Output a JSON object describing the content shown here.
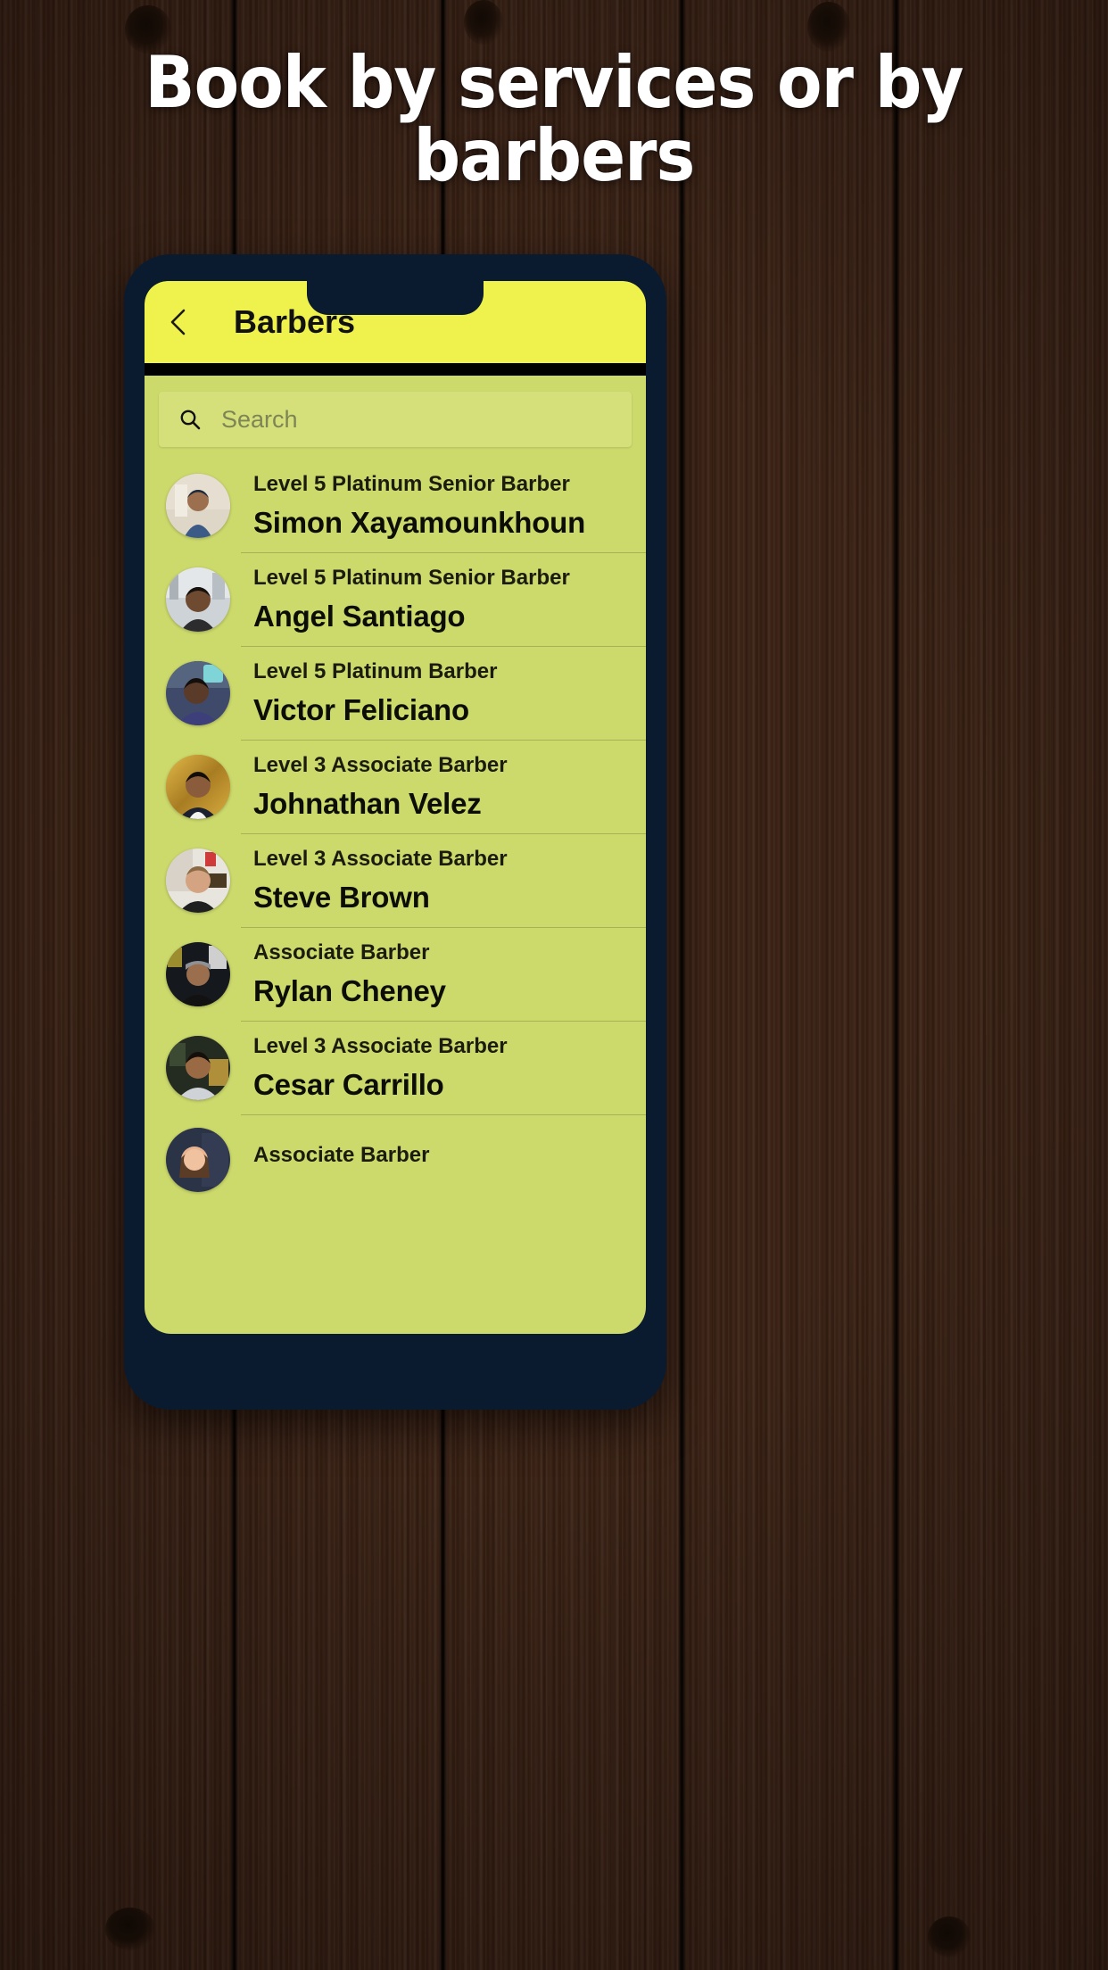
{
  "headline": "Book by services or by barbers",
  "phone": {
    "navbar": {
      "back_icon": "chevron-left-icon",
      "title": "Barbers"
    },
    "search": {
      "icon": "search-icon",
      "placeholder": "Search",
      "value": ""
    },
    "barbers": [
      {
        "level": "Level 5 Platinum Senior Barber",
        "name": "Simon Xayamounkhoun",
        "avatar": "photo-simon"
      },
      {
        "level": "Level 5 Platinum Senior Barber",
        "name": "Angel Santiago",
        "avatar": "photo-angel"
      },
      {
        "level": "Level 5 Platinum Barber",
        "name": "Victor Feliciano",
        "avatar": "photo-victor"
      },
      {
        "level": "Level 3 Associate Barber",
        "name": "Johnathan Velez",
        "avatar": "photo-johnathan"
      },
      {
        "level": "Level 3 Associate Barber",
        "name": "Steve Brown",
        "avatar": "photo-steve"
      },
      {
        "level": "Associate Barber",
        "name": "Rylan Cheney",
        "avatar": "photo-rylan"
      },
      {
        "level": "Level 3 Associate Barber",
        "name": "Cesar Carrillo",
        "avatar": "photo-cesar"
      },
      {
        "level": "Associate Barber",
        "name": "",
        "avatar": "photo-partial"
      }
    ]
  },
  "colors": {
    "navbar_yellow": "#EFF24D",
    "content_green": "#CCD96B",
    "search_green": "#D6E07A",
    "bezel_navy": "#0A1B30",
    "text_dark": "#0D0D07",
    "wood_brown": "#5A3520"
  }
}
